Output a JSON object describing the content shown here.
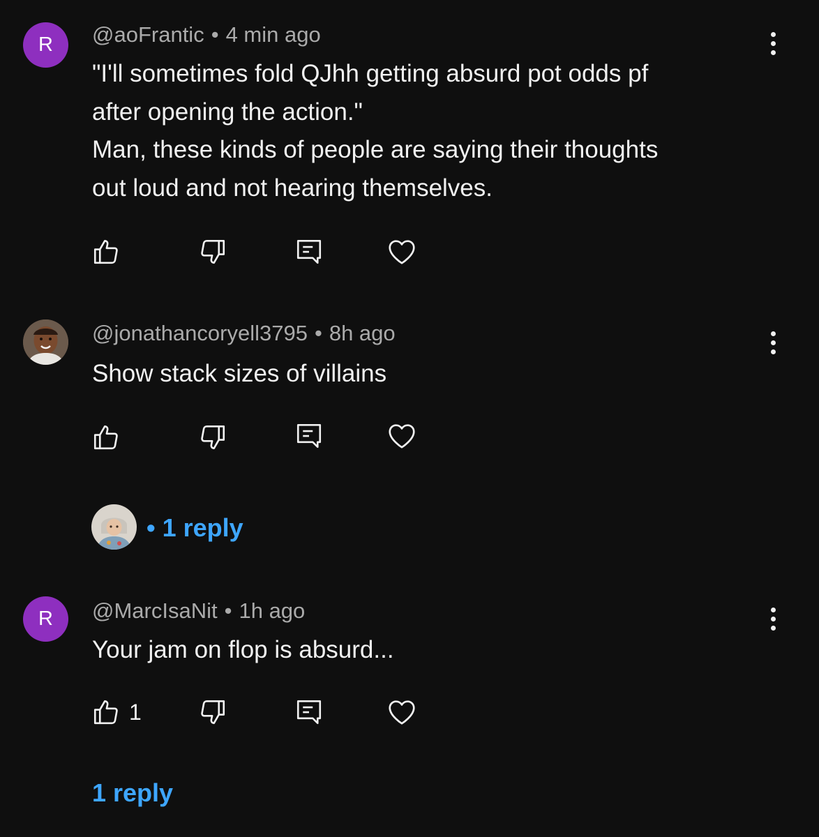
{
  "comments": [
    {
      "avatar_letter": "R",
      "author": "@aoFrantic",
      "separator": "•",
      "time": "4 min ago",
      "body_lines": [
        "\"I'll sometimes fold QJhh getting absurd pot odds pf",
        "after opening the action.\"",
        "Man, these kinds of people are saying their thoughts",
        "out loud and not hearing themselves."
      ],
      "like_count": ""
    },
    {
      "author": "@jonathancoryell3795",
      "separator": "•",
      "time": "8h ago",
      "body_lines": [
        "Show stack sizes of villains"
      ],
      "like_count": "",
      "replies": {
        "prefix": "•",
        "label": "1 reply"
      }
    },
    {
      "avatar_letter": "R",
      "author": "@MarcIsaNit",
      "separator": "•",
      "time": "1h ago",
      "body_lines": [
        "Your jam on flop is absurd..."
      ],
      "like_count": "1",
      "replies": {
        "label": "1 reply"
      }
    }
  ],
  "icons": {
    "like": "thumbs-up-icon",
    "dislike": "thumbs-down-icon",
    "reply": "comment-icon",
    "heart": "heart-icon",
    "more": "more-vertical-icon"
  },
  "colors": {
    "background": "#0f0f0f",
    "text": "#f1f1f1",
    "meta": "#aaaaaa",
    "link": "#3ea6ff",
    "avatar_purple": "#8e2fbf"
  }
}
